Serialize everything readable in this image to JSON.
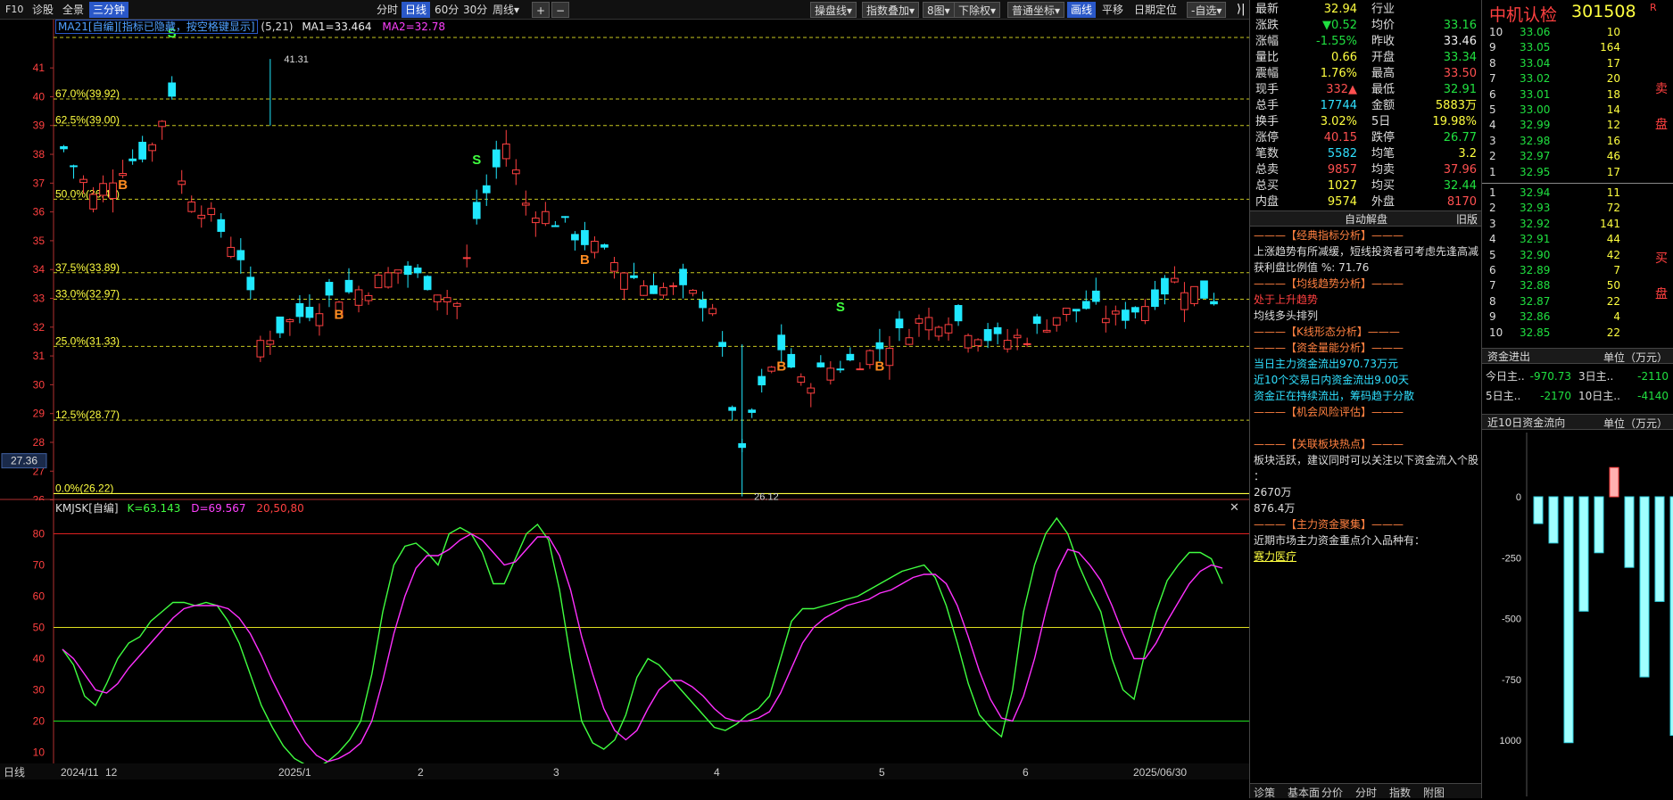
{
  "toolbar": {
    "left": [
      "F10",
      "诊股",
      "全景",
      "三分钟"
    ],
    "periods": [
      "分时",
      "日线",
      "60分",
      "30分",
      "周线▾"
    ],
    "plus": "+",
    "minus": "−",
    "right": [
      "操盘线▾",
      "指数叠加▾",
      "8图▾",
      "下除权▾",
      "普通坐标▾",
      "画线",
      "平移",
      "日期定位",
      "-自选▾"
    ]
  },
  "main_chart": {
    "indicator_label": "MA21[自编][指标已隐藏，按空格键显示]",
    "params": "(5,21)",
    "ma1": "MA1=33.464",
    "ma2": "MA2=32.78",
    "price_high_label": "41.31",
    "price_low_label": "26.12",
    "current_price_tag": "27.36",
    "yaxis_ticks": [
      "41",
      "40",
      "39",
      "38",
      "37",
      "36",
      "35",
      "34",
      "33",
      "32",
      "31",
      "30",
      "29",
      "28",
      "27",
      "26"
    ],
    "fib_levels": [
      {
        "label": "67.0%(39.92)",
        "price": 39.92
      },
      {
        "label": "62.5%(39.00)",
        "price": 39.0
      },
      {
        "label": "50.0%(36.44)",
        "price": 36.44
      },
      {
        "label": "37.5%(33.89)",
        "price": 33.89
      },
      {
        "label": "33.0%(32.97)",
        "price": 32.97
      },
      {
        "label": "25.0%(31.33)",
        "price": 31.33
      },
      {
        "label": "12.5%(28.77)",
        "price": 28.77
      },
      {
        "label": "0.0%(26.22)",
        "price": 26.22
      }
    ],
    "signals": [
      {
        "text": "B",
        "i": 6
      },
      {
        "text": "S",
        "i": 11
      },
      {
        "text": "S",
        "i": 42
      },
      {
        "text": "B",
        "i": 28
      },
      {
        "text": "B",
        "i": 53
      },
      {
        "text": "B",
        "i": 73
      },
      {
        "text": "S",
        "i": 79
      },
      {
        "text": "B",
        "i": 83
      }
    ]
  },
  "indicator_chart": {
    "label": "KMJSK[自编]",
    "k": "K=63.143",
    "d": "D=69.567",
    "levels_text": "20,50,80",
    "yaxis_ticks": [
      "80",
      "70",
      "60",
      "50",
      "40",
      "30",
      "20",
      "10"
    ]
  },
  "xaxis": {
    "period_btn": "日线",
    "labels": [
      "2024/11",
      "12",
      "2025/1",
      "2",
      "3",
      "4",
      "5",
      "6",
      "2025/06/30"
    ]
  },
  "quote": {
    "title": "中机认检",
    "code": "301508",
    "badge": "R",
    "rows": [
      [
        "最新",
        "32.94",
        "行业",
        ""
      ],
      [
        "涨跌",
        "▼0.52",
        "均价",
        "33.16"
      ],
      [
        "涨幅",
        "-1.55%",
        "昨收",
        "33.46"
      ],
      [
        "量比",
        "0.66",
        "开盘",
        "33.34"
      ],
      [
        "震幅",
        "1.76%",
        "最高",
        "33.50"
      ],
      [
        "现手",
        "332▲",
        "最低",
        "32.91"
      ],
      [
        "总手",
        "17744",
        "金额",
        "5883万"
      ],
      [
        "换手",
        "3.02%",
        "5日",
        "19.98%"
      ],
      [
        "涨停",
        "40.15",
        "跌停",
        "26.77"
      ],
      [
        "笔数",
        "5582",
        "均笔",
        "3.2"
      ],
      [
        "总卖",
        "9857",
        "均卖",
        "37.96"
      ],
      [
        "总买",
        "1027",
        "均买",
        "32.44"
      ],
      [
        "内盘",
        "9574",
        "外盘",
        "8170"
      ]
    ],
    "auto_title": "自动解盘",
    "old_btn": "旧版",
    "analysis": [
      "———【经典指标分析】———",
      "上涨趋势有所减缓，短线投资者可考虑先逢高减",
      "获利盘比例值 %: 71.76",
      "———【均线趋势分析】———",
      "处于上升趋势",
      "均线多头排列",
      "———【K线形态分析】———",
      "———【资金量能分析】———",
      "当日主力资金流出970.73万元",
      "近10个交易日内资金流出9.00天",
      "资金正在持续流出，筹码趋于分散",
      "———【机会风险评估】———",
      "",
      "———【关联板块热点】———",
      " 板块活跃，建议同时可以关注以下资金流入个股",
      "：",
      " 2670万",
      " 876.4万",
      "———【主力资金聚集】———",
      "近期市场主力资金重点介入品种有：",
      " 赛力医疗"
    ],
    "tabs": [
      "诊策",
      "基本面",
      "分价",
      "分时",
      "指数",
      "附图"
    ]
  },
  "book": {
    "sell_label": "卖盘",
    "buy_label": "买盘",
    "sells": [
      [
        "10",
        "33.06",
        "10"
      ],
      [
        "9",
        "33.05",
        "164"
      ],
      [
        "8",
        "33.04",
        "17"
      ],
      [
        "7",
        "33.02",
        "20"
      ],
      [
        "6",
        "33.01",
        "18"
      ],
      [
        "5",
        "33.00",
        "14"
      ],
      [
        "4",
        "32.99",
        "12"
      ],
      [
        "3",
        "32.98",
        "16"
      ],
      [
        "2",
        "32.97",
        "46"
      ],
      [
        "1",
        "32.95",
        "17"
      ]
    ],
    "buys": [
      [
        "1",
        "32.94",
        "11"
      ],
      [
        "2",
        "32.93",
        "72"
      ],
      [
        "3",
        "32.92",
        "141"
      ],
      [
        "4",
        "32.91",
        "44"
      ],
      [
        "5",
        "32.90",
        "42"
      ],
      [
        "6",
        "32.89",
        "7"
      ],
      [
        "7",
        "32.88",
        "50"
      ],
      [
        "8",
        "32.87",
        "22"
      ],
      [
        "9",
        "32.86",
        "4"
      ],
      [
        "10",
        "32.85",
        "22"
      ]
    ],
    "flow_title": "资金进出",
    "flow_unit": "单位（万元）",
    "flow": [
      [
        "今日主..",
        "-970.73",
        "3日主..",
        "-2110"
      ],
      [
        "5日主..",
        "-2170",
        "10日主..",
        "-4140"
      ]
    ],
    "flow10_title": "近10日资金流向",
    "flow10_unit": "单位（万元）",
    "flow10_ticks": [
      "0",
      "-250",
      "-500",
      "-750",
      "1000"
    ]
  },
  "chart_data": {
    "type": "candlestick",
    "flow10_values": [
      -110,
      -190,
      -1010,
      -470,
      -230,
      120,
      -290,
      -740,
      -430,
      -980
    ],
    "kd_k": [
      43,
      38,
      28,
      25,
      32,
      40,
      45,
      47,
      52,
      55,
      58,
      58,
      57,
      58,
      57,
      52,
      45,
      35,
      25,
      18,
      12,
      8,
      6,
      5,
      7,
      10,
      14,
      20,
      35,
      55,
      70,
      76,
      77,
      74,
      70,
      80,
      82,
      80,
      74,
      64,
      64,
      72,
      80,
      83,
      78,
      62,
      40,
      20,
      13,
      11,
      14,
      22,
      34,
      40,
      38,
      34,
      30,
      26,
      22,
      18,
      17,
      19,
      22,
      24,
      28,
      40,
      52,
      56,
      56,
      57,
      58,
      59,
      60,
      62,
      64,
      66,
      68,
      69,
      70,
      66,
      57,
      45,
      32,
      22,
      18,
      15,
      30,
      55,
      70,
      80,
      85,
      80,
      70,
      62,
      55,
      40,
      30,
      27,
      42,
      55,
      65,
      70,
      74,
      74,
      72,
      64
    ],
    "kd_d": [
      43,
      40,
      35,
      30,
      29,
      32,
      37,
      41,
      45,
      49,
      53,
      56,
      57,
      57,
      57,
      56,
      53,
      48,
      41,
      33,
      26,
      19,
      13,
      9,
      7,
      8,
      10,
      13,
      20,
      33,
      48,
      60,
      69,
      73,
      73,
      75,
      78,
      80,
      78,
      74,
      70,
      71,
      75,
      79,
      79,
      73,
      62,
      47,
      35,
      24,
      17,
      14,
      17,
      24,
      30,
      33,
      33,
      31,
      28,
      24,
      21,
      20,
      20,
      21,
      23,
      29,
      37,
      45,
      50,
      53,
      55,
      57,
      58,
      59,
      61,
      62,
      64,
      66,
      67,
      67,
      64,
      57,
      47,
      36,
      27,
      21,
      20,
      28,
      40,
      55,
      68,
      75,
      74,
      70,
      65,
      57,
      48,
      40,
      40,
      45,
      52,
      58,
      64,
      68,
      70,
      69
    ]
  }
}
